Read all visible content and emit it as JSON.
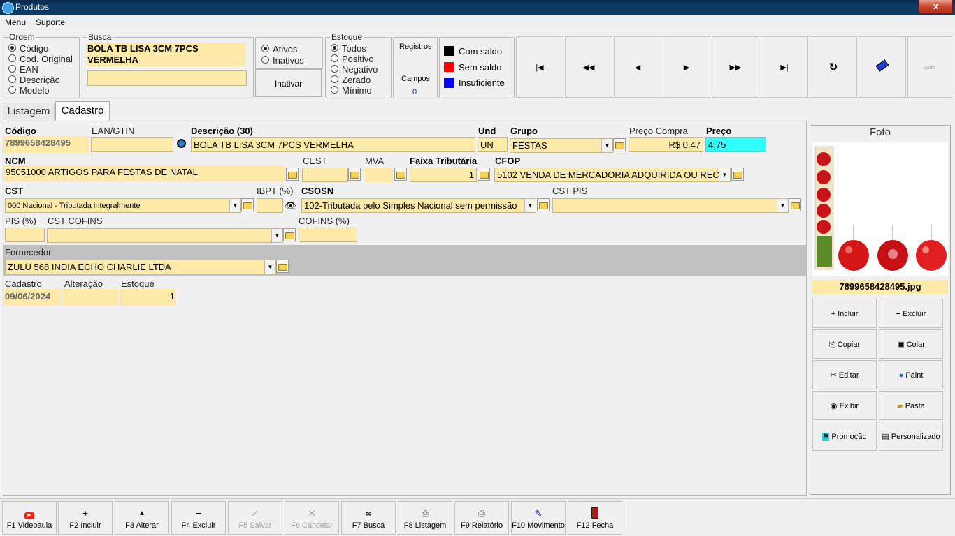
{
  "window": {
    "title": "Produtos",
    "close_symbol": "x"
  },
  "menu": {
    "items": [
      "Menu",
      "Suporte"
    ]
  },
  "ordem": {
    "title": "Ordem",
    "options": [
      "Código",
      "Cod. Original",
      "EAN",
      "Descrição",
      "Modelo"
    ],
    "selected": "Código"
  },
  "busca": {
    "title": "Busca",
    "value": "BOLA TB LISA 3CM 7PCS VERMELHA",
    "input_value": ""
  },
  "status": {
    "options": [
      "Ativos",
      "Inativos"
    ],
    "selected": "Ativos",
    "inativar_label": "Inativar"
  },
  "estoque": {
    "title": "Estoque",
    "options": [
      "Todos",
      "Positivo",
      "Negativo",
      "Zerado",
      "Mínimo"
    ],
    "selected": "Todos"
  },
  "registros": {
    "label": "Registros",
    "campos_label": "Campos",
    "campos_value": "0"
  },
  "legend": {
    "items": [
      {
        "label": "Com saldo",
        "color": "#000000"
      },
      {
        "label": "Sem saldo",
        "color": "#ff0000"
      },
      {
        "label": "Insuficiente",
        "color": "#0000ff"
      }
    ]
  },
  "nav": {
    "buttons": [
      {
        "name": "first",
        "icon": "first-icon",
        "glyph": "⏮"
      },
      {
        "name": "prev-page",
        "icon": "rewind-icon",
        "glyph": "◂◂"
      },
      {
        "name": "prev",
        "icon": "prev-icon",
        "glyph": "◂"
      },
      {
        "name": "next",
        "icon": "next-icon",
        "glyph": "▸"
      },
      {
        "name": "next-page",
        "icon": "fast-forward-icon",
        "glyph": "▸▸"
      },
      {
        "name": "last",
        "icon": "last-icon",
        "glyph": "⏭"
      },
      {
        "name": "refresh",
        "icon": "refresh-icon",
        "glyph": "↻"
      },
      {
        "name": "eraser",
        "icon": "eraser-icon",
        "glyph": "▰"
      },
      {
        "name": "goto",
        "icon": "goto-icon",
        "glyph": "Goto"
      }
    ]
  },
  "tabs": {
    "listagem": "Listagem",
    "cadastro": "Cadastro"
  },
  "form": {
    "codigo_label": "Código",
    "codigo_value": "7899658428495",
    "ean_label": "EAN/GTIN",
    "ean_value": "",
    "descricao_label": "Descrição (30)",
    "descricao_value": "BOLA TB LISA 3CM 7PCS VERMELHA",
    "und_label": "Und",
    "und_value": "UN",
    "grupo_label": "Grupo",
    "grupo_value": "FESTAS",
    "preco_compra_label": "Preço Compra",
    "preco_compra_value": "R$ 0.47",
    "preco_label": "Preço",
    "preco_value": "4.75",
    "ncm_label": "NCM",
    "ncm_value": "95051000 ARTIGOS PARA FESTAS DE NATAL",
    "cest_label": "CEST",
    "cest_value": "",
    "mva_label": "MVA",
    "mva_value": "",
    "faixa_label": "Faixa Tributária",
    "faixa_value": "1",
    "cfop_label": "CFOP",
    "cfop_value": "5102 VENDA DE MERCADORIA ADQUIRIDA OU REC",
    "cst_label": "CST",
    "cst_value": "000 Nacional - Tributada integralmente",
    "ibpt_label": "IBPT (%)",
    "ibpt_value": "",
    "csosn_label": "CSOSN",
    "csosn_value": "102-Tributada pelo Simples Nacional sem permissão",
    "cst_pis_label": "CST PIS",
    "cst_pis_value": "",
    "pis_label": "PIS (%)",
    "pis_value": "",
    "cst_cofins_label": "CST COFINS",
    "cst_cofins_value": "",
    "cofins_label": "COFINS (%)",
    "cofins_value": "",
    "fornecedor_label": "Fornecedor",
    "fornecedor_value": "ZULU 568 INDIA ECHO CHARLIE LTDA",
    "cadastro_label": "Cadastro",
    "cadastro_value": "09/06/2024",
    "alteracao_label": "Alteração",
    "alteracao_value": "",
    "estoque_label": "Estoque",
    "estoque_value": "1",
    "preco_bg": "#33ffff"
  },
  "foto": {
    "title": "Foto",
    "filename": "7899658428495.jpg"
  },
  "photo_actions": [
    {
      "label": "Incluir",
      "icon": "plus-icon",
      "glyph": "+"
    },
    {
      "label": "Excluir",
      "icon": "minus-icon",
      "glyph": "−"
    },
    {
      "label": "Copiar",
      "icon": "copy-icon",
      "glyph": "⎘"
    },
    {
      "label": "Colar",
      "icon": "paste-icon",
      "glyph": "📋"
    },
    {
      "label": "Editar",
      "icon": "scissors-icon",
      "glyph": "✂"
    },
    {
      "label": "Paint",
      "icon": "palette-icon",
      "glyph": "🎨"
    },
    {
      "label": "Exibir",
      "icon": "eye-icon",
      "glyph": "👁"
    },
    {
      "label": "Pasta",
      "icon": "folder-icon",
      "glyph": "📂"
    },
    {
      "label": "Promoção",
      "icon": "promo-icon",
      "glyph": "🏃"
    },
    {
      "label": "Personalizado",
      "icon": "card-icon",
      "glyph": "▤"
    }
  ],
  "bottom": [
    {
      "label": "F1 Videoaula",
      "icon": "youtube-icon",
      "glyph": "▶",
      "enabled": true
    },
    {
      "label": "F2 Incluir",
      "icon": "plus-icon",
      "glyph": "+",
      "enabled": true
    },
    {
      "label": "F3 Alterar",
      "icon": "up-icon",
      "glyph": "▲",
      "enabled": true
    },
    {
      "label": "F4 Excluir",
      "icon": "minus-icon",
      "glyph": "−",
      "enabled": true
    },
    {
      "label": "F5 Salvar",
      "icon": "check-icon",
      "glyph": "✓",
      "enabled": false
    },
    {
      "label": "F6 Cancelar",
      "icon": "x-icon",
      "glyph": "✕",
      "enabled": false
    },
    {
      "label": "F7 Busca",
      "icon": "binoculars-icon",
      "glyph": "⌕",
      "enabled": true
    },
    {
      "label": "F8 Listagem",
      "icon": "printer-icon",
      "glyph": "⎙",
      "enabled": true
    },
    {
      "label": "F9 Relatório",
      "icon": "printer-icon",
      "glyph": "⎙",
      "enabled": true
    },
    {
      "label": "F10 Movimento",
      "icon": "document-check-icon",
      "glyph": "✎",
      "enabled": true
    },
    {
      "label": "F12 Fecha",
      "icon": "door-icon",
      "glyph": "▮",
      "enabled": true
    }
  ]
}
